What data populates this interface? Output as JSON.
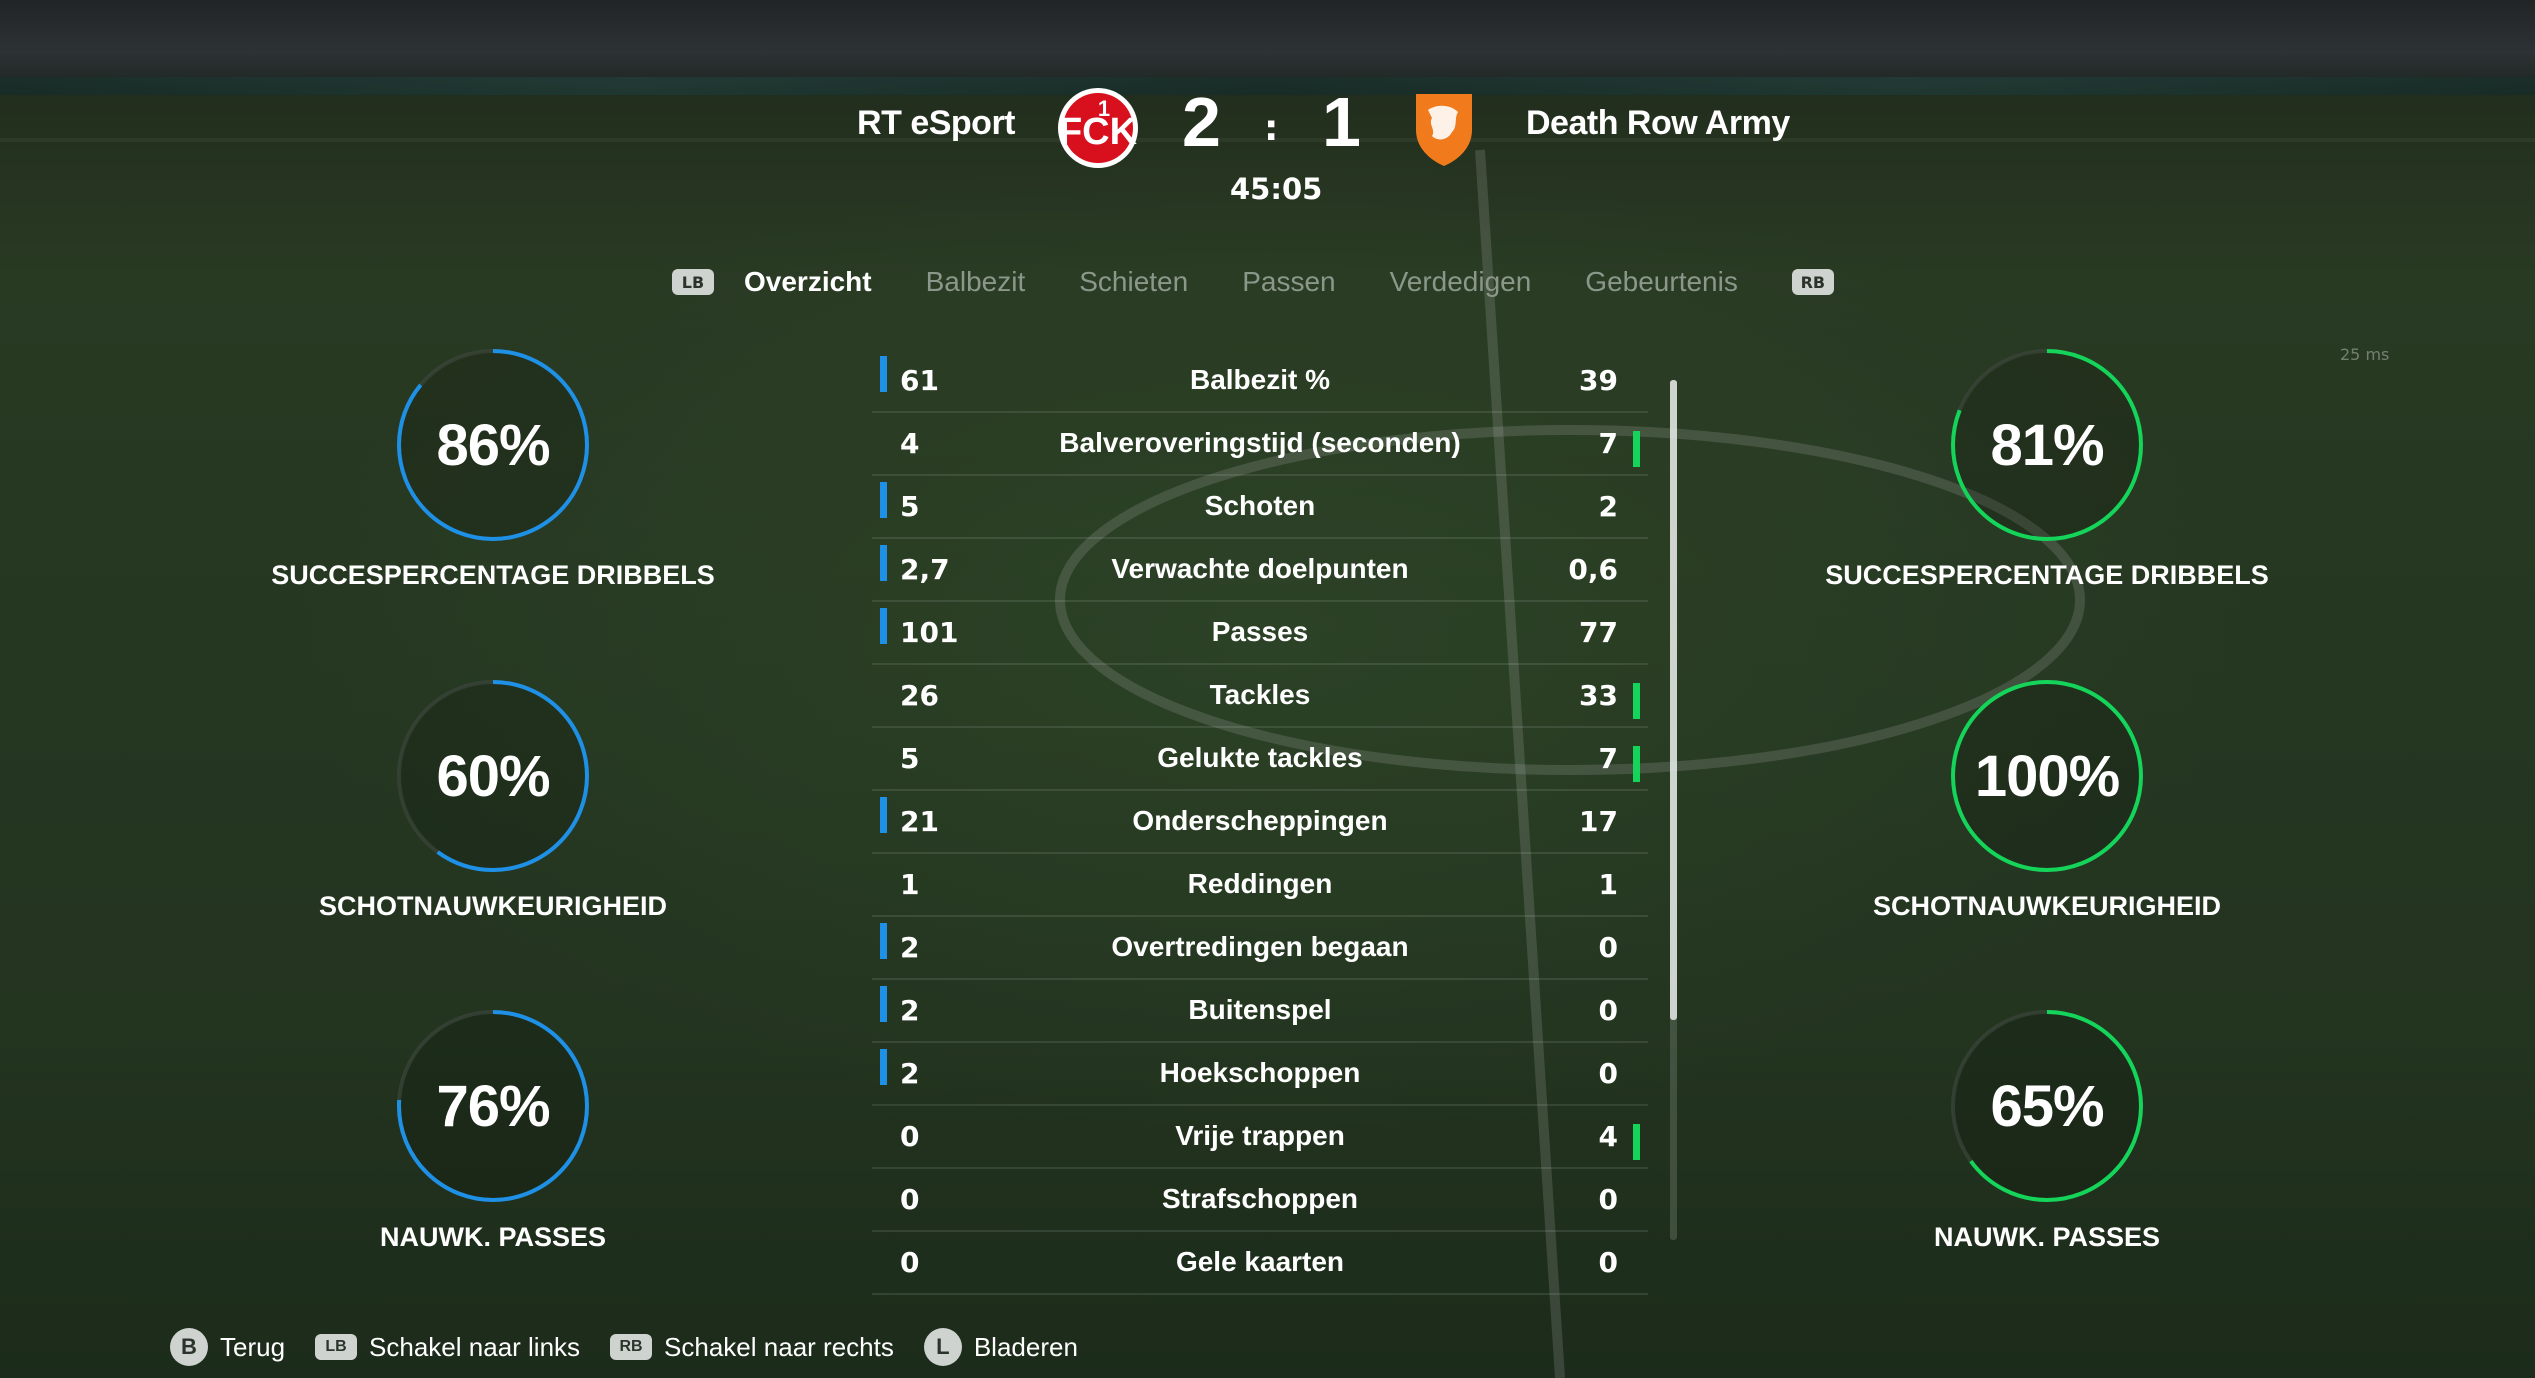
{
  "scoreboard": {
    "home_team": "RT eSport",
    "away_team": "Death Row Army",
    "home_score": "2",
    "away_score": "1",
    "separator": ":",
    "clock": "45:05"
  },
  "tabs": {
    "lb": "LB",
    "rb": "RB",
    "items": [
      "Overzicht",
      "Balbezit",
      "Schieten",
      "Passen",
      "Verdedigen",
      "Gebeurtenis"
    ],
    "active": "Overzicht"
  },
  "latency": "25 ms",
  "home_gauges": [
    {
      "value": "86%",
      "fraction": 0.86,
      "label": "SUCCESPERCENTAGE DRIBBELS"
    },
    {
      "value": "60%",
      "fraction": 0.6,
      "label": "SCHOTNAUWKEURIGHEID"
    },
    {
      "value": "76%",
      "fraction": 0.76,
      "label": "NAUWK. PASSES"
    }
  ],
  "away_gauges": [
    {
      "value": "81%",
      "fraction": 0.81,
      "label": "SUCCESPERCENTAGE DRIBBELS"
    },
    {
      "value": "100%",
      "fraction": 1.0,
      "label": "SCHOTNAUWKEURIGHEID"
    },
    {
      "value": "65%",
      "fraction": 0.65,
      "label": "NAUWK. PASSES"
    }
  ],
  "stats": [
    {
      "name": "Balbezit %",
      "home": "61",
      "away": "39",
      "leader": "home"
    },
    {
      "name": "Balveroveringstijd (seconden)",
      "home": "4",
      "away": "7",
      "leader": "away"
    },
    {
      "name": "Schoten",
      "home": "5",
      "away": "2",
      "leader": "home"
    },
    {
      "name": "Verwachte doelpunten",
      "home": "2,7",
      "away": "0,6",
      "leader": "home"
    },
    {
      "name": "Passes",
      "home": "101",
      "away": "77",
      "leader": "home"
    },
    {
      "name": "Tackles",
      "home": "26",
      "away": "33",
      "leader": "away"
    },
    {
      "name": "Gelukte tackles",
      "home": "5",
      "away": "7",
      "leader": "away"
    },
    {
      "name": "Onderscheppingen",
      "home": "21",
      "away": "17",
      "leader": "home"
    },
    {
      "name": "Reddingen",
      "home": "1",
      "away": "1",
      "leader": "none"
    },
    {
      "name": "Overtredingen begaan",
      "home": "2",
      "away": "0",
      "leader": "home"
    },
    {
      "name": "Buitenspel",
      "home": "2",
      "away": "0",
      "leader": "home"
    },
    {
      "name": "Hoekschoppen",
      "home": "2",
      "away": "0",
      "leader": "home"
    },
    {
      "name": "Vrije trappen",
      "home": "0",
      "away": "4",
      "leader": "away"
    },
    {
      "name": "Strafschoppen",
      "home": "0",
      "away": "0",
      "leader": "none"
    },
    {
      "name": "Gele kaarten",
      "home": "0",
      "away": "0",
      "leader": "none"
    }
  ],
  "footer": {
    "back": {
      "key": "B",
      "label": "Terug"
    },
    "left": {
      "key": "LB",
      "label": "Schakel naar links"
    },
    "right": {
      "key": "RB",
      "label": "Schakel naar rechts"
    },
    "scroll": {
      "key": "L",
      "label": "Bladeren"
    }
  },
  "colors": {
    "home": "#1e90e6",
    "away": "#14d45a",
    "home_crest": "#d8101e",
    "away_crest": "#f07a1c"
  }
}
